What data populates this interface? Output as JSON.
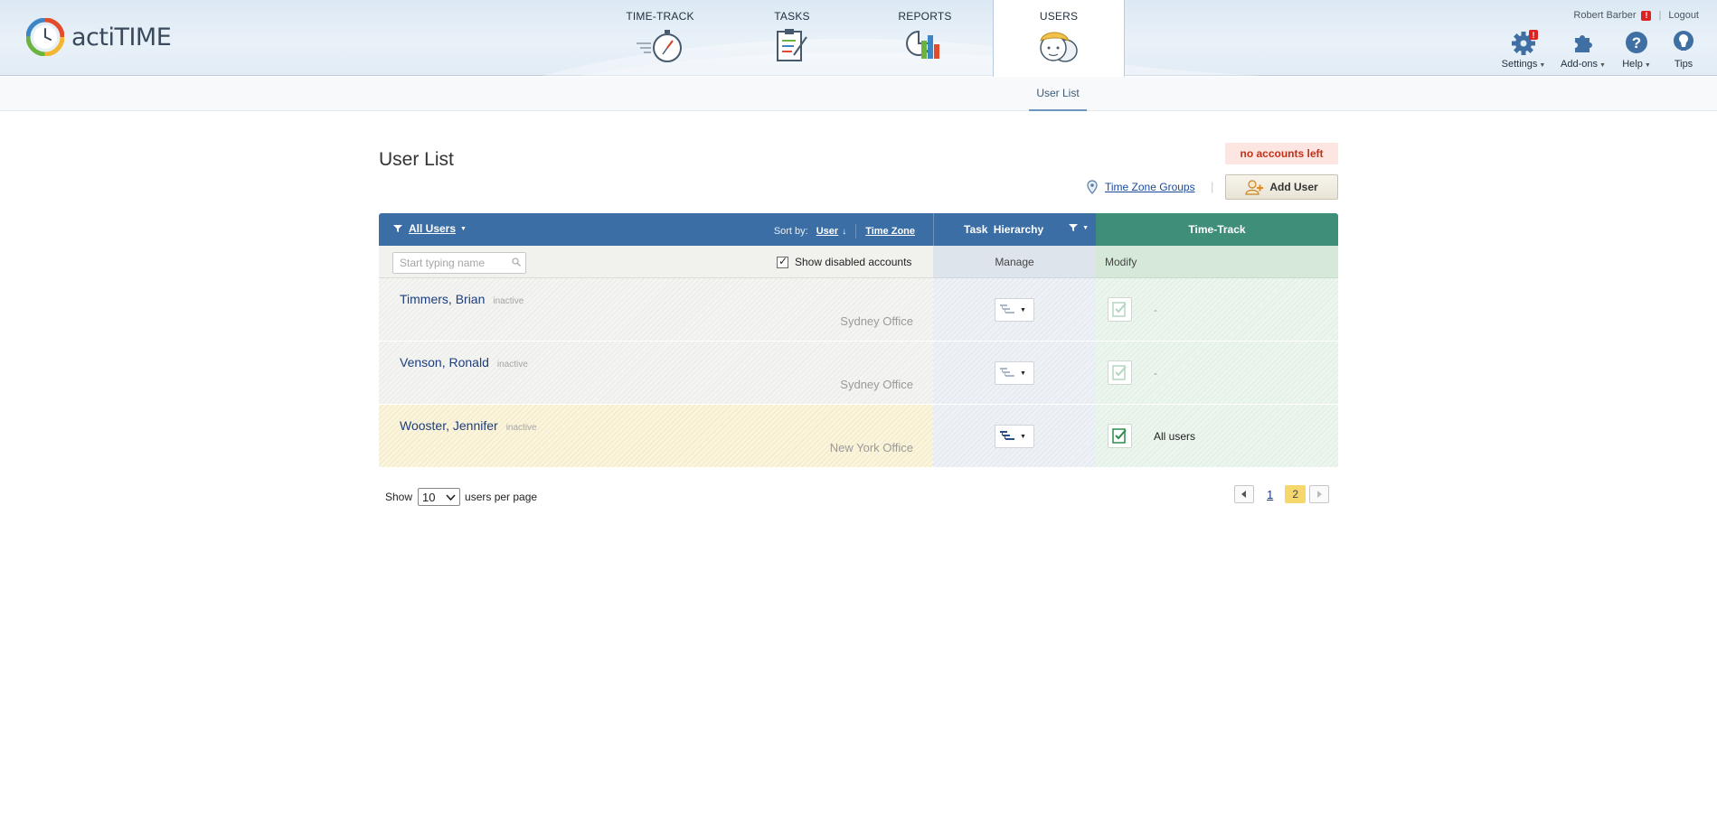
{
  "app": {
    "name": "actiTIME"
  },
  "nav": {
    "tabs": [
      {
        "label": "TIME-TRACK",
        "icon": "stopwatch-icon"
      },
      {
        "label": "TASKS",
        "icon": "clipboard-icon"
      },
      {
        "label": "REPORTS",
        "icon": "chart-icon"
      },
      {
        "label": "USERS",
        "icon": "users-icon",
        "active": true
      }
    ]
  },
  "account": {
    "user": "Robert Barber",
    "alert": "!",
    "separator": "|",
    "logout": "Logout"
  },
  "tools": {
    "settings": {
      "label": "Settings",
      "badge": "!"
    },
    "addons": {
      "label": "Add-ons"
    },
    "help": {
      "label": "Help"
    },
    "tips": {
      "label": "Tips"
    }
  },
  "subnav": {
    "items": [
      {
        "label": "User List",
        "active": true
      }
    ]
  },
  "page": {
    "title": "User List",
    "no_accounts": "no accounts left",
    "tz_groups": "Time Zone Groups",
    "add_user": "Add User"
  },
  "table": {
    "filter_label": "All Users",
    "sort_by": "Sort by:",
    "sort_user": "User",
    "sort_timezone": "Time Zone",
    "task_hierarchy": "Task Hierarchy",
    "time_track": "Time-Track",
    "search_placeholder": "Start typing name",
    "show_disabled": "Show disabled accounts",
    "show_disabled_checked": true,
    "manage": "Manage",
    "modify": "Modify",
    "rows": [
      {
        "name": "Timmers, Brian",
        "status": "inactive",
        "tz": "Sydney Office",
        "tt": "-",
        "enabled": false
      },
      {
        "name": "Venson, Ronald",
        "status": "inactive",
        "tz": "Sydney Office",
        "tt": "-",
        "enabled": false
      },
      {
        "name": "Wooster, Jennifer",
        "status": "inactive",
        "tz": "New York Office",
        "tt": "All users",
        "enabled": true
      }
    ]
  },
  "paging": {
    "show": "Show",
    "per_page_value": "10",
    "per_page_suffix": "users per page",
    "pages": [
      "1",
      "2"
    ],
    "current": "2"
  },
  "colors": {
    "header_blue": "#3c6ea6",
    "header_green": "#3f8e7a",
    "link_blue": "#1d3d7e",
    "alert_red": "#dd2222",
    "current_page": "#f5d76b"
  }
}
